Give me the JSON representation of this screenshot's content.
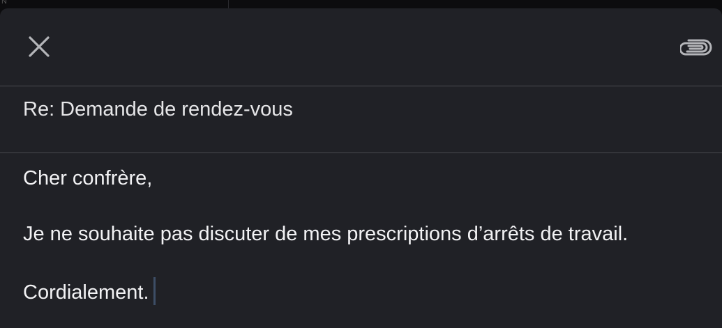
{
  "compose": {
    "subject": "Re: Demande de rendez-vous",
    "body": {
      "greeting": "Cher confrère,",
      "message": "Je ne souhaite pas discuter de mes prescriptions d’arrêts de travail.",
      "closing": "Cordialement."
    }
  },
  "toolbar": {
    "close_icon": "close-icon",
    "attach_icon": "paperclip-icon"
  },
  "colors": {
    "background": "#202126",
    "text": "#f2f2f4",
    "separator": "#4a4b50",
    "caret": "#3d4e66"
  }
}
